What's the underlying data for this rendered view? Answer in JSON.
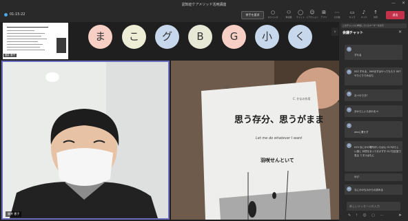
{
  "window": {
    "title": "認知症ケアメソッド活用講座",
    "timer": "01:15:22",
    "minimize": "—",
    "close": "✕"
  },
  "toolbar": {
    "raise_hand_label": "挙手を要求",
    "tools": [
      {
        "icon": "○",
        "label": "ホワイトボ"
      },
      {
        "icon": "⚇",
        "label": "参加者"
      },
      {
        "icon": "◯",
        "label": "チャット"
      },
      {
        "icon": "☺",
        "label": "リアクション"
      },
      {
        "icon": "⊞",
        "label": "アプリ"
      },
      {
        "icon": "⋯",
        "label": "その他"
      },
      {
        "icon": "▭",
        "label": "カメラ"
      },
      {
        "icon": "♪",
        "label": "マイク"
      },
      {
        "icon": "↑",
        "label": "共有"
      }
    ],
    "leave_label": "退出"
  },
  "shared_slide": {
    "name_label": "福井 恵子"
  },
  "reaction_bubbles": [
    {
      "char": "ま",
      "color": "#f7cfc4"
    },
    {
      "char": "こ",
      "color": "#eeeed7"
    },
    {
      "char": "グ",
      "color": "#c8d8ec"
    },
    {
      "char": "B",
      "color": "#e8e8d6"
    },
    {
      "char": "G",
      "color": "#f7cfc4"
    },
    {
      "char": "小",
      "color": "#c8d8ec"
    },
    {
      "char": "く",
      "color": "#c8d8ec"
    }
  ],
  "video_left": {
    "name": "福井 恵子"
  },
  "video_right": {
    "book_page": "017",
    "chapter_hint": "C. かなの作用",
    "book_heading": "思う存分、思うがまま",
    "book_subtitle": "Let me do whatever I want",
    "book_author": "羽咲せんといて"
  },
  "chat": {
    "notice": "このチャットに参加しているユーザーを表示",
    "title": "会議チャット",
    "expand_arrow": "›",
    "messages": [
      {
        "avatar": "N",
        "text": "ずれる"
      },
      {
        "avatar": "T",
        "text": "002 ずれる、006まずはやってもらう 007 やりとりでみるも"
      },
      {
        "avatar": "F",
        "text": "おぺやでき？"
      },
      {
        "avatar": "K",
        "text": "分からしいらあれをペ"
      },
      {
        "avatar": "S",
        "text": "ohaに着せず"
      },
      {
        "avatar": "T",
        "text": "015 なにかの場所がいらばん 017ほらしい感じ 対境をまっておけずす 017日記室で見る てすけばもに"
      },
      {
        "avatar": "Y",
        "text": "ゆび"
      },
      {
        "avatar": "H",
        "text": "なにかのものからの試みる"
      }
    ],
    "input_placeholder": "新しいメッセージの入力",
    "tools": "✎ ! ☺ ▢ ⋯",
    "send_icon": "➤"
  }
}
